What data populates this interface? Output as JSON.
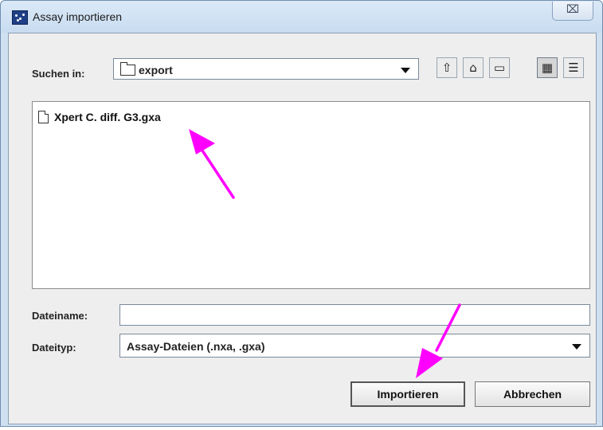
{
  "window": {
    "title": "Assay importieren",
    "close_glyph": "⌧",
    "app_icon": "app-icon"
  },
  "look_in": {
    "label": "Suchen in:",
    "value": "export"
  },
  "toolbar": {
    "buttons": [
      "up-folder-icon",
      "home-icon",
      "new-folder-icon",
      "list-view-icon",
      "details-view-icon"
    ],
    "glyphs": [
      "⇧",
      "⌂",
      "▭",
      "▦",
      "☰"
    ]
  },
  "files": [
    {
      "name": "Xpert C. diff. G3.gxa",
      "icon": "file-icon"
    }
  ],
  "filename": {
    "label": "Dateiname:",
    "value": ""
  },
  "filetype": {
    "label": "Dateityp:",
    "value": "Assay-Dateien (.nxa, .gxa)"
  },
  "buttons": {
    "import": "Importieren",
    "cancel": "Abbrechen"
  },
  "colors": {
    "annotation_arrow": "#ff00ff",
    "title_bar": "#cfe0f1"
  }
}
